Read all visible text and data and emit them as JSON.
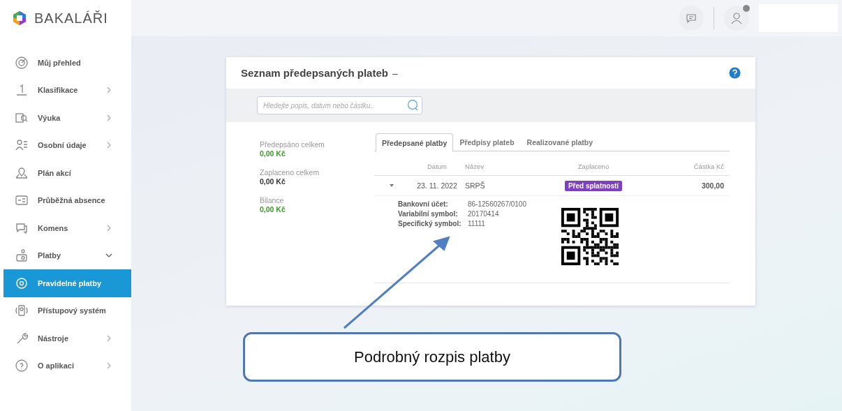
{
  "logo": {
    "text": "BAKALÁŘI"
  },
  "sidebar": {
    "items": [
      {
        "label": "Můj přehled",
        "selected": false
      },
      {
        "label": "Klasifikace",
        "expanded": false,
        "selected": false
      },
      {
        "label": "Výuka",
        "expanded": false,
        "selected": false
      },
      {
        "label": "Osobní údaje",
        "expanded": false,
        "selected": false
      },
      {
        "label": "Plán akcí",
        "selected": false
      },
      {
        "label": "Průběžná absence",
        "selected": false
      },
      {
        "label": "Komens",
        "expanded": false,
        "selected": false
      },
      {
        "label": "Platby",
        "expanded": true,
        "selected": false
      },
      {
        "label": "Pravidelné platby",
        "selected": true
      },
      {
        "label": "Přístupový systém",
        "selected": false
      },
      {
        "label": "Nástroje",
        "expanded": false,
        "selected": false
      },
      {
        "label": "O aplikaci",
        "expanded": false,
        "selected": false
      }
    ]
  },
  "card": {
    "title": "Seznam předepsaných plateb",
    "title_suffix": "–",
    "search": {
      "placeholder": "Hledejte popis, datum nebo částku.."
    },
    "summary": [
      {
        "label": "Předepsáno celkem",
        "value": "0,00 Kč",
        "color": "#3a9a2a"
      },
      {
        "label": "Zaplaceno celkem",
        "value": "0,00 Kč",
        "color": "#333333"
      },
      {
        "label": "Bilance",
        "value": "0,00 Kč",
        "color": "#3a9a2a"
      }
    ],
    "tabs": [
      {
        "label": "Předepsané platby",
        "selected": true
      },
      {
        "label": "Předpisy plateb",
        "selected": false
      },
      {
        "label": "Realizované platby",
        "selected": false
      }
    ],
    "table": {
      "columns": [
        "Datum",
        "Název",
        "Zaplaceno",
        "Částka Kč"
      ],
      "rows": [
        {
          "expanded": true,
          "date": "23. 11. 2022",
          "name": "SRPŠ",
          "status": "Před splatností",
          "amount": "300,00",
          "details": [
            {
              "label": "Bankovní účet:",
              "value": "86-12560267/0100"
            },
            {
              "label": "Variabilní symbol:",
              "value": "20170414"
            },
            {
              "label": "Specifický symbol:",
              "value": "11111"
            }
          ]
        }
      ]
    }
  },
  "callout": {
    "text": "Podrobný rozpis platby"
  }
}
